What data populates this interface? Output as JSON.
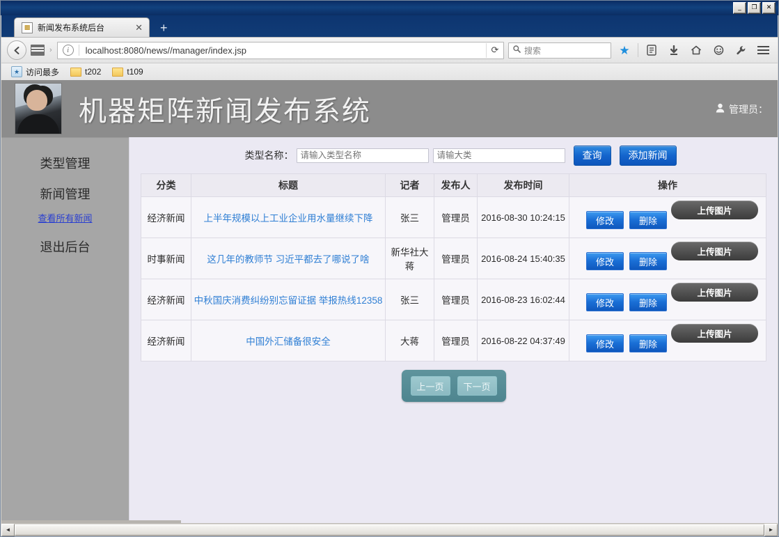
{
  "window": {
    "minimize_label": "_",
    "maximize_label": "❐",
    "close_label": "✕"
  },
  "browser": {
    "tab": {
      "title": "新闻发布系统后台",
      "favicon": "news-favicon",
      "close_label": "✕"
    },
    "new_tab_label": "+",
    "back_label": "◀",
    "chevron_label": "›",
    "info_label": "i",
    "url": "localhost:8080/news//manager/index.jsp",
    "reload_label": "⟳",
    "search": {
      "icon": "search-icon",
      "placeholder": "搜索",
      "value": ""
    },
    "toolbar_icons": [
      {
        "name": "bookmark-star-icon",
        "glyph": "★"
      },
      {
        "name": "library-icon",
        "glyph": "▤"
      },
      {
        "name": "downloads-icon",
        "glyph": "⬇"
      },
      {
        "name": "home-icon",
        "glyph": "⌂"
      },
      {
        "name": "share-smiley-icon",
        "glyph": "☺"
      },
      {
        "name": "developer-wrench-icon",
        "glyph": "🔧"
      }
    ],
    "bookmarks": [
      {
        "label": "访问最多",
        "icon": "most-visited-icon"
      },
      {
        "label": "t202",
        "icon": "folder-icon"
      },
      {
        "label": "t109",
        "icon": "folder-icon"
      }
    ]
  },
  "page": {
    "header": {
      "title": "机器矩阵新闻发布系统",
      "avatar_alt": "portrait-photo",
      "admin_icon": "user-icon",
      "admin_label": "管理员："
    },
    "sidebar": {
      "items": [
        {
          "label": "类型管理",
          "type": "main"
        },
        {
          "label": "新闻管理",
          "type": "main"
        },
        {
          "label": "查看所有新闻",
          "type": "sub"
        },
        {
          "label": "退出后台",
          "type": "main"
        }
      ]
    },
    "filter": {
      "label": "类型名称：",
      "type_input": {
        "value": "",
        "placeholder": "请输入类型名称"
      },
      "category_input": {
        "value": "",
        "placeholder": "请输大类"
      },
      "query_button": "查询",
      "add_button": "添加新闻"
    },
    "table": {
      "headers": [
        "分类",
        "标题",
        "记者",
        "发布人",
        "发布时间",
        "操作"
      ],
      "rows": [
        {
          "category": "经济新闻",
          "title": "上半年规模以上工业企业用水量继续下降",
          "reporter": "张三",
          "publisher": "管理员",
          "time": "2016-08-30 10:24:15",
          "edit": "修改",
          "delete": "删除",
          "upload": "上传图片"
        },
        {
          "category": "时事新闻",
          "title": "这几年的教师节 习近平都去了哪说了啥",
          "reporter": "新华社大蒋",
          "publisher": "管理员",
          "time": "2016-08-24 15:40:35",
          "edit": "修改",
          "delete": "删除",
          "upload": "上传图片"
        },
        {
          "category": "经济新闻",
          "title": "中秋国庆消费纠纷别忘留证据 举报热线12358",
          "reporter": "张三",
          "publisher": "管理员",
          "time": "2016-08-23 16:02:44",
          "edit": "修改",
          "delete": "删除",
          "upload": "上传图片"
        },
        {
          "category": "经济新闻",
          "title": "中国外汇储备很安全",
          "reporter": "大蒋",
          "publisher": "管理员",
          "time": "2016-08-22 04:37:49",
          "edit": "修改",
          "delete": "删除",
          "upload": "上传图片"
        }
      ]
    },
    "pagination": {
      "prev": "上一页",
      "next": "下一页"
    }
  },
  "scrollbar": {
    "left_arrow": "◄",
    "right_arrow": "►"
  },
  "colors": {
    "accent_blue": "#1464cc",
    "link_blue": "#2f7fd4",
    "header_gray": "#8c8c8c",
    "sidebar_gray": "#a6a6a6",
    "content_bg": "#ebe9f3",
    "upload_dark": "#525252",
    "pager_teal": "#5f949d"
  }
}
